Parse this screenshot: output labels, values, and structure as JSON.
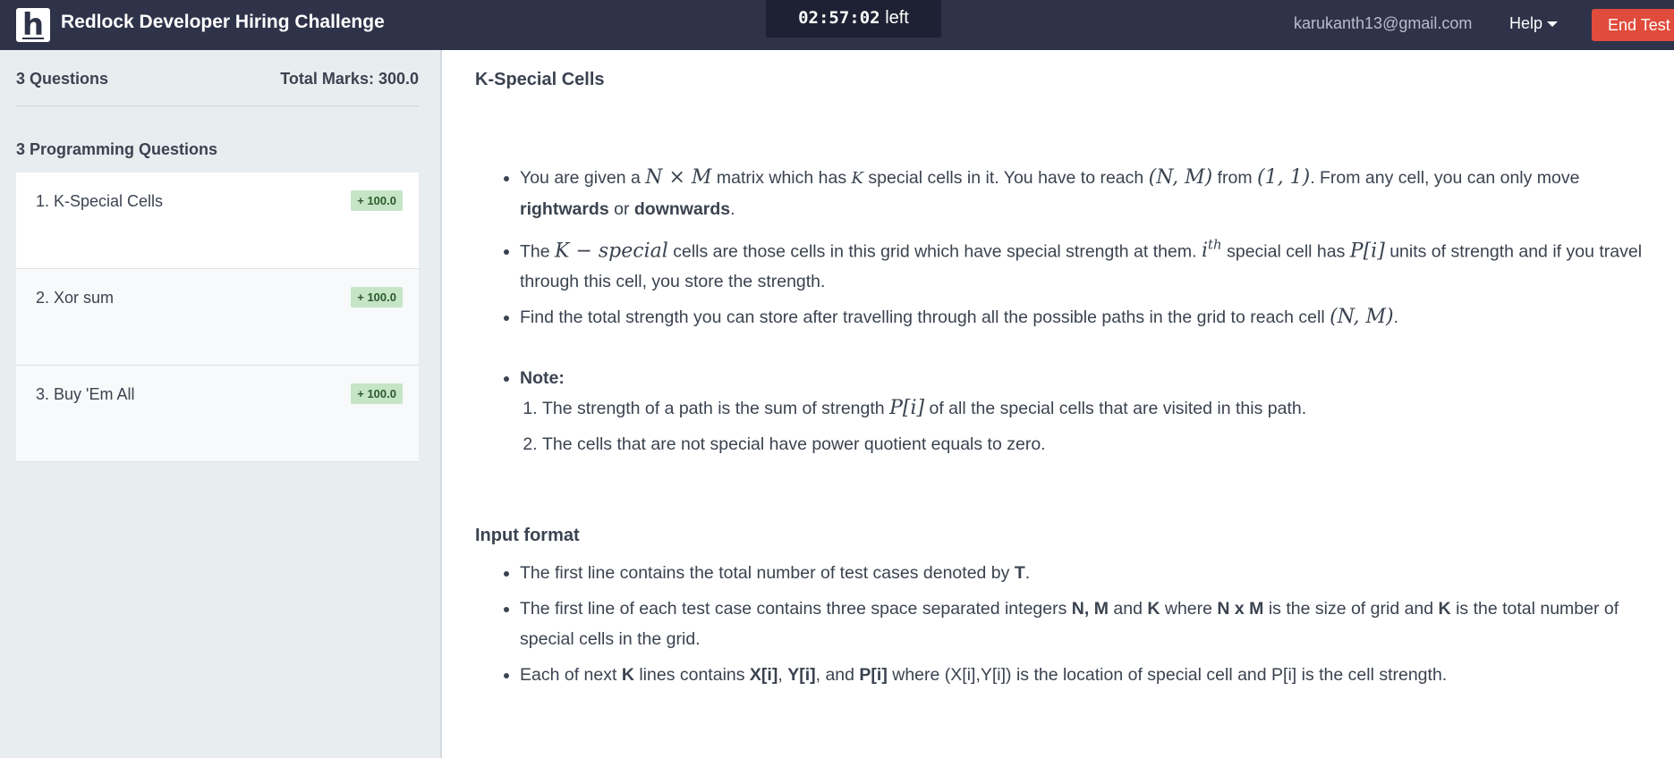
{
  "header": {
    "logo_letter": "h",
    "app_title": "Redlock Developer Hiring Challenge",
    "timer_value": "02:57:02",
    "timer_suffix": "left",
    "email": "karukanth13@gmail.com",
    "help_label": "Help",
    "end_test_label": "End Test",
    "end_test_color": "#e04b3b",
    "bar_color": "#2f3349"
  },
  "sidebar": {
    "question_count": "3 Questions",
    "total_marks": "Total Marks: 300.0",
    "section_title": "3 Programming Questions",
    "questions": [
      {
        "title": "1. K-Special Cells",
        "marks": "+ 100.0"
      },
      {
        "title": "2. Xor sum",
        "marks": "+ 100.0"
      },
      {
        "title": "3. Buy 'Em All",
        "marks": "+ 100.0"
      }
    ]
  },
  "problem": {
    "title": "K-Special Cells",
    "p1": {
      "a": "You are given a",
      "m1": "N × M",
      "b": "matrix which has",
      "m2": "K",
      "c": "special cells in it. You have to reach",
      "m3": "(N, M)",
      "d": "from",
      "m4": "(1, 1)",
      "e": ". From any cell, you can only move",
      "bold1": "rightwards",
      "f": "or",
      "bold2": "downwards",
      "g": "."
    },
    "p2": {
      "a": "The",
      "m1": "K − special",
      "b": "cells are those cells in this grid which have special strength at them.",
      "m2": "i",
      "m2sup": "th",
      "c": "special cell has",
      "m3": "P[i]",
      "d": "units of strength and if you travel through this cell, you store the strength."
    },
    "p3": {
      "a": "Find the total strength you can store after travelling through all the possible paths in the grid to reach cell",
      "m1": "(N, M)",
      "b": "."
    },
    "note_label": "Note:",
    "note1": {
      "a": "The strength of a path is the sum of strength",
      "m1": "P[i]",
      "b": "of all the special cells that are visited in this path."
    },
    "note2": "The cells that are not special have power quotient equals to zero.",
    "input_title": "Input format",
    "in1": {
      "a": "The first line contains the total number of test cases denoted by",
      "b": "T",
      "c": "."
    },
    "in2": {
      "a": "The first line of each test case contains three space separated integers",
      "b": "N, M",
      "c": "and",
      "d": "K",
      "e": "where",
      "f": "N x M",
      "g": "is the size of grid and",
      "h": "K",
      "i": "is the total number of special cells in the grid."
    },
    "in3": {
      "a": "Each of next",
      "b": "K",
      "c": "lines contains",
      "d": "X[i]",
      "e": ",",
      "f": "Y[i]",
      "g": ", and",
      "h": "P[i]",
      "i": "where (X[i],Y[i]) is the location of special cell and P[i] is the cell strength."
    }
  }
}
